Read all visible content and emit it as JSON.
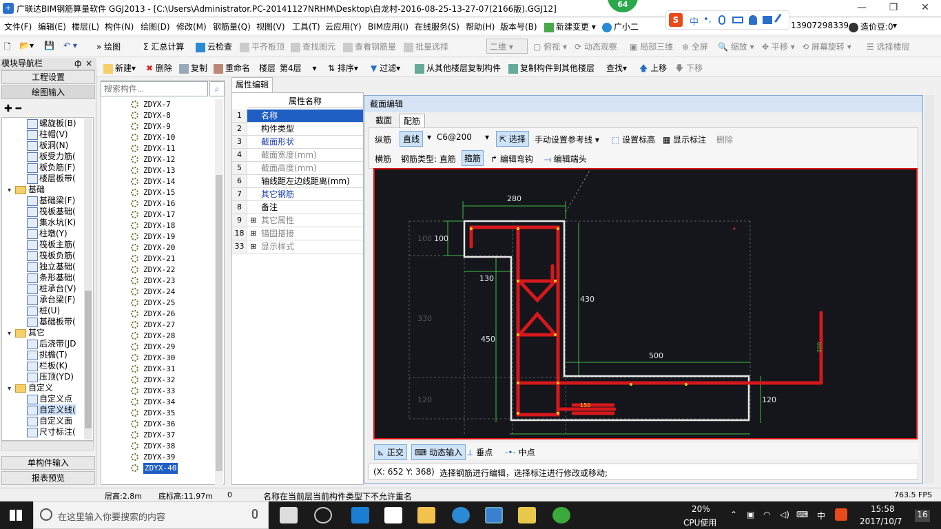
{
  "window": {
    "title": "广联达BIM钢筋算量软件 GGJ2013 - [C:\\Users\\Administrator.PC-20141127NRHM\\Desktop\\白龙村-2016-08-25-13-27-07(2166版).GGJ12]",
    "badge": "64",
    "minimize": "—",
    "restore": "❐",
    "close": "✕"
  },
  "menu": [
    "文件(F)",
    "编辑(E)",
    "楼层(L)",
    "构件(N)",
    "绘图(D)",
    "修改(M)",
    "钢筋量(Q)",
    "视图(V)",
    "工具(T)",
    "云应用(Y)",
    "BIM应用(I)",
    "在线服务(S)",
    "帮助(H)",
    "版本号(B)",
    "新建变更",
    "广小二",
    "13907298339",
    "造价豆:0"
  ],
  "ime": {
    "logo": "S",
    "items": [
      "中",
      "•,",
      "🎤",
      "⌨",
      "👤",
      "👕",
      "🔧"
    ]
  },
  "toolbar1": {
    "items": [
      "绘图",
      "汇总计算",
      "云检查",
      "平齐板顶",
      "查找图元",
      "查看钢筋量",
      "批量选择",
      "二维",
      "俯视",
      "动态观察",
      "局部三维",
      "全屏",
      "缩放",
      "平移",
      "屏幕旋转",
      "选择楼层"
    ]
  },
  "toolbar2": {
    "items": [
      "新建",
      "删除",
      "复制",
      "重命名",
      "楼层",
      "第4层",
      "排序",
      "过滤",
      "从其他楼层复制构件",
      "复制构件到其他楼层",
      "查找",
      "上移",
      "下移"
    ]
  },
  "leftpanel": {
    "header": "模块导航栏",
    "pin": "ф",
    "close": "×",
    "buttons": [
      "工程设置",
      "绘图输入",
      "单构件输入",
      "报表预览"
    ],
    "tree": [
      {
        "label": "螺旋板(B)",
        "level": 2
      },
      {
        "label": "柱帽(V)",
        "level": 2
      },
      {
        "label": "板洞(N)",
        "level": 2
      },
      {
        "label": "板受力筋(",
        "level": 2
      },
      {
        "label": "板负筋(F)",
        "level": 2
      },
      {
        "label": "楼层板带(",
        "level": 2
      },
      {
        "label": "基础",
        "level": 1
      },
      {
        "label": "基础梁(F)",
        "level": 2
      },
      {
        "label": "筏板基础(",
        "level": 2
      },
      {
        "label": "集水坑(K)",
        "level": 2
      },
      {
        "label": "柱墩(Y)",
        "level": 2
      },
      {
        "label": "筏板主筋(",
        "level": 2
      },
      {
        "label": "筏板负筋(",
        "level": 2
      },
      {
        "label": "独立基础(",
        "level": 2
      },
      {
        "label": "条形基础(",
        "level": 2
      },
      {
        "label": "桩承台(V)",
        "level": 2
      },
      {
        "label": "承台梁(F)",
        "level": 2
      },
      {
        "label": "桩(U)",
        "level": 2
      },
      {
        "label": "基础板带(",
        "level": 2
      },
      {
        "label": "其它",
        "level": 1
      },
      {
        "label": "后浇带(JD",
        "level": 2
      },
      {
        "label": "挑檐(T)",
        "level": 2
      },
      {
        "label": "栏板(K)",
        "level": 2
      },
      {
        "label": "压顶(YD)",
        "level": 2
      },
      {
        "label": "自定义",
        "level": 1
      },
      {
        "label": "自定义点",
        "level": 2
      },
      {
        "label": "自定义线(",
        "level": 2
      },
      {
        "label": "自定义面",
        "level": 2
      },
      {
        "label": "尺寸标注(",
        "level": 2
      }
    ]
  },
  "list": {
    "search_placeholder": "搜索构件...",
    "items": [
      "ZDYX-7",
      "ZDYX-8",
      "ZDYX-9",
      "ZDYX-10",
      "ZDYX-11",
      "ZDYX-12",
      "ZDYX-13",
      "ZDYX-14",
      "ZDYX-15",
      "ZDYX-16",
      "ZDYX-17",
      "ZDYX-18",
      "ZDYX-19",
      "ZDYX-20",
      "ZDYX-21",
      "ZDYX-22",
      "ZDYX-23",
      "ZDYX-24",
      "ZDYX-25",
      "ZDYX-26",
      "ZDYX-27",
      "ZDYX-28",
      "ZDYX-29",
      "ZDYX-30",
      "ZDYX-31",
      "ZDYX-32",
      "ZDYX-33",
      "ZDYX-34",
      "ZDYX-35",
      "ZDYX-36",
      "ZDYX-37",
      "ZDYX-38",
      "ZDYX-39",
      "ZDYX-40"
    ],
    "selected": "ZDYX-40"
  },
  "props": {
    "tab": "属性编辑",
    "header": "属性名称",
    "rows": [
      {
        "idx": "1",
        "name": "名称",
        "color": "#fff",
        "sel": true
      },
      {
        "idx": "2",
        "name": "构件类型",
        "color": "#000"
      },
      {
        "idx": "3",
        "name": "截面形状",
        "color": "#1d3fb5"
      },
      {
        "idx": "4",
        "name": "截面宽度(mm)",
        "color": "#888"
      },
      {
        "idx": "5",
        "name": "截面高度(mm)",
        "color": "#888"
      },
      {
        "idx": "6",
        "name": "轴线距左边线距离(mm)",
        "color": "#000"
      },
      {
        "idx": "7",
        "name": "其它钢筋",
        "color": "#1d3fb5"
      },
      {
        "idx": "8",
        "name": "备注",
        "color": "#000"
      },
      {
        "idx": "9",
        "name": "其它属性",
        "color": "#888",
        "exp": true
      },
      {
        "idx": "18",
        "name": "锚固搭接",
        "color": "#888",
        "exp": true
      },
      {
        "idx": "33",
        "name": "显示样式",
        "color": "#888",
        "exp": true
      }
    ]
  },
  "dialog": {
    "title": "截面编辑",
    "tabs": [
      "截面",
      "配筋"
    ],
    "row1": {
      "zongjin": "纵筋",
      "line": "直线",
      "spec": "C6@200",
      "select": "选择",
      "manual": "手动设置参考线",
      "setmark": "设置标高",
      "showmark": "显示标注",
      "delete": "删除"
    },
    "row2": {
      "hengjin": "横筋",
      "type": "钢筋类型: 直筋",
      "gujin": "箍筋",
      "editbend": "编辑弯钩",
      "editend": "编辑端头"
    },
    "bottom": {
      "ortho": "正交",
      "dyninput": "动态输入",
      "perp": "垂点",
      "mid": "中点"
    },
    "coords": "(X: 652 Y: 368)",
    "hint": "选择钢筋进行编辑，选择标注进行修改或移动;"
  },
  "drawing": {
    "dims": [
      "280",
      "100",
      "130",
      "430",
      "450",
      "500",
      "120",
      "200",
      "150",
      "100",
      "330",
      "120"
    ]
  },
  "status": {
    "floor_h": "层高:2.8m",
    "bottom_h": "底标高:11.97m",
    "count": "0",
    "msg": "名称在当前层当前构件类型下不允许重名",
    "fps": "763.5 FPS"
  },
  "taskbar": {
    "search": "在这里输入你要搜索的内容",
    "cpu_pct": "20%",
    "cpu_label": "CPU使用",
    "ime": "中",
    "time": "15:58",
    "date": "2017/10/7",
    "notif": "16"
  }
}
